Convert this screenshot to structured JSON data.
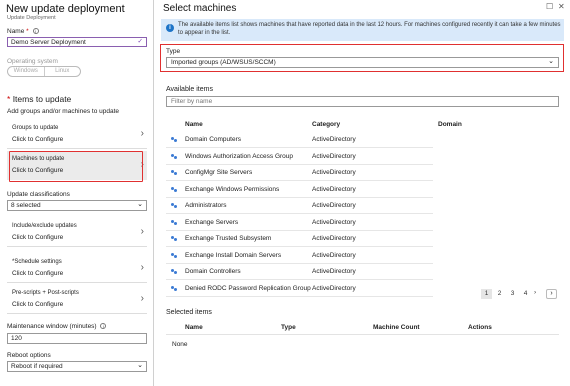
{
  "left_blade": {
    "title": "New update deployment",
    "subtitle": "Update Deployment",
    "name_label": "Name",
    "name_required": "*",
    "name_value": "Demo Server Deployment",
    "os_label": "Operating system",
    "os_options": [
      "Windows",
      "Linux"
    ],
    "items_heading": "* Items to update",
    "items_desc": "Add groups and/or machines to update",
    "groups": {
      "title": "Groups to update",
      "sub": "Click to Configure"
    },
    "machines": {
      "title": "Machines to update",
      "sub": "Click to Configure"
    },
    "classifications_label": "Update classifications",
    "classifications_value": "8 selected",
    "include": {
      "title": "Include/exclude updates",
      "sub": "Click to Configure"
    },
    "schedule": {
      "title": "*Schedule settings",
      "sub": "Click to Configure"
    },
    "scripts": {
      "title": "Pre-scripts + Post-scripts",
      "sub": "Click to Configure"
    },
    "maintenance_label": "Maintenance window (minutes)",
    "maintenance_value": "120",
    "reboot_label": "Reboot options",
    "reboot_value": "Reboot if required"
  },
  "right_blade": {
    "title": "Select machines",
    "banner": "The available items list shows machines that have reported data in the last 12 hours. For machines configured recently it can take a few minutes to appear in the list.",
    "type_label": "Type",
    "type_value": "Imported groups (AD/WSUS/SCCM)",
    "available_label": "Available items",
    "filter_placeholder": "Filter by name",
    "columns": [
      "Name",
      "Category",
      "Domain"
    ],
    "rows": [
      {
        "name": "Domain Computers",
        "category": "ActiveDirectory"
      },
      {
        "name": "Windows Authorization Access Group",
        "category": "ActiveDirectory"
      },
      {
        "name": "ConfigMgr Site Servers",
        "category": "ActiveDirectory"
      },
      {
        "name": "Exchange Windows Permissions",
        "category": "ActiveDirectory"
      },
      {
        "name": "Administrators",
        "category": "ActiveDirectory"
      },
      {
        "name": "Exchange Servers",
        "category": "ActiveDirectory"
      },
      {
        "name": "Exchange Trusted Subsystem",
        "category": "ActiveDirectory"
      },
      {
        "name": "Exchange Install Domain Servers",
        "category": "ActiveDirectory"
      },
      {
        "name": "Domain Controllers",
        "category": "ActiveDirectory"
      },
      {
        "name": "Denied RODC Password Replication Group",
        "category": "ActiveDirectory"
      }
    ],
    "pages": [
      "1",
      "2",
      "3",
      "4"
    ],
    "selected_label": "Selected items",
    "selected_columns": [
      "Name",
      "Type",
      "Machine Count",
      "Actions"
    ],
    "selected_empty": "None"
  },
  "colors": {
    "highlight_red": "#e03030",
    "info_blue": "#1d74c8",
    "banner_bg": "#d9e9fa"
  }
}
